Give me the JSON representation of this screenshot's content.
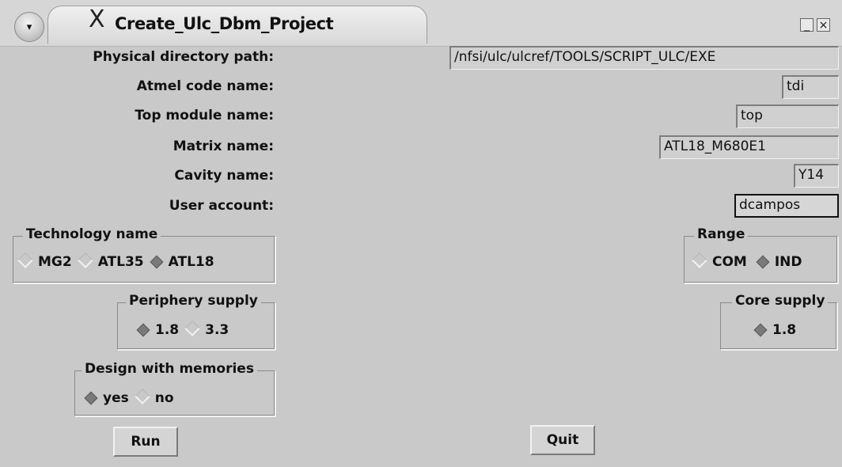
{
  "window": {
    "title": "Create_Ulc_Dbm_Project",
    "menu_glyph": "▾",
    "x_glyph": "X",
    "minimize_glyph": "_",
    "close_glyph": "×"
  },
  "fields": {
    "physical_directory_path": {
      "label": "Physical directory path:",
      "value": "/nfsi/ulc/ulcref/TOOLS/SCRIPT_ULC/EXE"
    },
    "atmel_code_name": {
      "label": "Atmel code name:",
      "value": "tdi"
    },
    "top_module_name": {
      "label": "Top module name:",
      "value": "top"
    },
    "matrix_name": {
      "label": "Matrix name:",
      "value": "ATL18_M680E1"
    },
    "cavity_name": {
      "label": "Cavity name:",
      "value": "Y14"
    },
    "user_account": {
      "label": "User account:",
      "value": "dcampos"
    }
  },
  "technology": {
    "title": "Technology name",
    "options": [
      "MG2",
      "ATL35",
      "ATL18"
    ],
    "selected": "ATL18"
  },
  "range": {
    "title": "Range",
    "options": [
      "COM",
      "IND"
    ],
    "selected": "IND"
  },
  "periphery_supply": {
    "title": "Periphery supply",
    "options": [
      "1.8",
      "3.3"
    ],
    "selected": "1.8"
  },
  "core_supply": {
    "title": "Core supply",
    "options": [
      "1.8"
    ],
    "selected": "1.8"
  },
  "memories": {
    "title": "Design with memories",
    "options": [
      "yes",
      "no"
    ],
    "selected": "yes"
  },
  "buttons": {
    "run": "Run",
    "quit": "Quit"
  }
}
